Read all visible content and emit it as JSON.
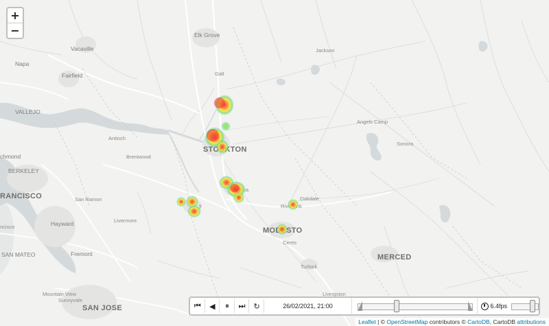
{
  "map": {
    "labels": [
      {
        "id": "elk-grove",
        "text": "Elk Grove",
        "size": "mid"
      },
      {
        "id": "vacaville",
        "text": "Vacaville",
        "size": "mid"
      },
      {
        "id": "jackson",
        "text": "Jackson",
        "size": "small"
      },
      {
        "id": "napa",
        "text": "Napa",
        "size": "mid"
      },
      {
        "id": "fairfield",
        "text": "Fairfield",
        "size": "mid"
      },
      {
        "id": "galt",
        "text": "Galt",
        "size": "small"
      },
      {
        "id": "vallejo",
        "text": "VALLEJO",
        "size": "mid"
      },
      {
        "id": "angels-camp",
        "text": "Angels Camp",
        "size": "small"
      },
      {
        "id": "antioch",
        "text": "Antioch",
        "size": "small"
      },
      {
        "id": "sonora",
        "text": "Sonora",
        "size": "small"
      },
      {
        "id": "brentwood",
        "text": "Brentwood",
        "size": "small"
      },
      {
        "id": "stockton",
        "text": "STOCKTON",
        "size": "big"
      },
      {
        "id": "richmond",
        "text": "chmond",
        "size": "mid"
      },
      {
        "id": "berkeley",
        "text": "BERKELEY",
        "size": "mid"
      },
      {
        "id": "manteca",
        "text": "teca",
        "size": "small"
      },
      {
        "id": "oakdale",
        "text": "Oakdale",
        "size": "small"
      },
      {
        "id": "francisco",
        "text": "RANCISCO",
        "size": "big"
      },
      {
        "id": "san-ramon",
        "text": "San Ramon",
        "size": "small"
      },
      {
        "id": "riverbank",
        "text": "Rivel  ank",
        "size": "small"
      },
      {
        "id": "livermore",
        "text": "Livermore",
        "size": "small"
      },
      {
        "id": "tracy",
        "text": "y",
        "size": "small"
      },
      {
        "id": "hayward",
        "text": "Hayward",
        "size": "mid"
      },
      {
        "id": "modesto",
        "text": "MODESTO",
        "size": "big"
      },
      {
        "id": "ncisco",
        "text": "ncisco",
        "size": "small"
      },
      {
        "id": "ceres",
        "text": "Ceres",
        "size": "small"
      },
      {
        "id": "san-mateo",
        "text": "SAN MATEO",
        "size": "mid"
      },
      {
        "id": "fremont",
        "text": "Fremont",
        "size": "mid"
      },
      {
        "id": "merced",
        "text": "MERCED",
        "size": "big"
      },
      {
        "id": "turlock",
        "text": "Turlock",
        "size": "small"
      },
      {
        "id": "mountain-view",
        "text": "Mountain View",
        "size": "small"
      },
      {
        "id": "sunnyvale",
        "text": "Sunnyvale",
        "size": "small"
      },
      {
        "id": "livingston",
        "text": "Livingston",
        "size": "small"
      },
      {
        "id": "san-jose",
        "text": "SAN JOSE",
        "size": "big"
      }
    ],
    "zoom_in": "+",
    "zoom_out": "−"
  },
  "player": {
    "btn_first": "⏮",
    "btn_back": "◀",
    "btn_pause": "⏸",
    "btn_forward": "▶",
    "btn_last": "⏭",
    "btn_loop": "↻",
    "datetime": "26/02/2021, 21:00",
    "time_position": 0.33,
    "fps_label": "6.4fps",
    "fps_position": 0.8
  },
  "attribution": {
    "leaflet": "Leaflet",
    "sep1": " | © ",
    "osm": "OpenStreetMap",
    "contrib": " contributors © ",
    "cartodb": "CartoDB",
    "carto_sep": ", CartoDB ",
    "attributions": "attributions"
  },
  "colors": {
    "water": "#d4dadc",
    "land": "#f2f2f0",
    "road": "#ffffff",
    "heat_low": "#4fb3e8",
    "heat_mid": "#7ee35a",
    "heat_high": "#f7e83a",
    "heat_hot": "#f23d2d",
    "link": "#0078a8"
  }
}
